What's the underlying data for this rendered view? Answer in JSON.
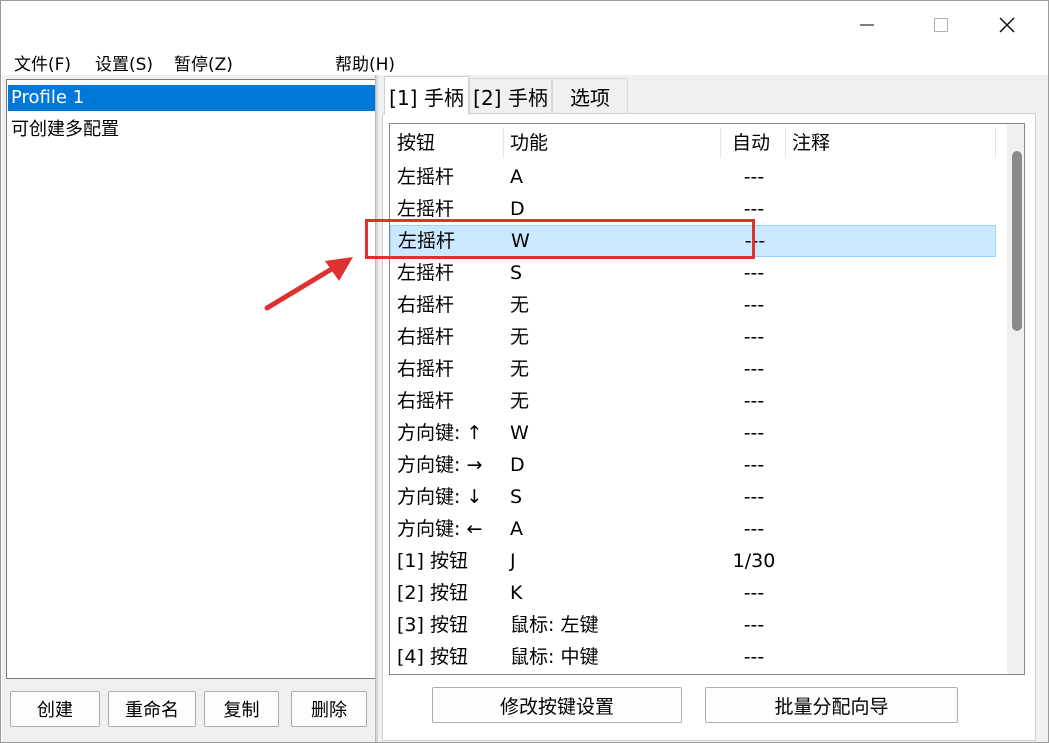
{
  "window": {
    "controls": {
      "minimize": "minimize-icon",
      "maximize": "maximize-icon",
      "close": "close-icon"
    }
  },
  "menu": {
    "file": "文件(F)",
    "settings": "设置(S)",
    "pause": "暂停(Z)",
    "help": "帮助(H)"
  },
  "profiles": {
    "items": [
      {
        "label": "Profile 1"
      },
      {
        "label": "可创建多配置"
      }
    ],
    "selected_index": 0,
    "buttons": {
      "create": "创建",
      "rename": "重命名",
      "copy": "复制",
      "delete": "删除"
    }
  },
  "tabs": [
    {
      "label": "[1] 手柄"
    },
    {
      "label": "[2] 手柄"
    },
    {
      "label": "选项"
    }
  ],
  "active_tab": 0,
  "table": {
    "columns": [
      "按钮",
      "功能",
      "自动",
      "注释"
    ],
    "rows": [
      {
        "button": "左摇杆",
        "function": "A",
        "auto": "---",
        "note": ""
      },
      {
        "button": "左摇杆",
        "function": "D",
        "auto": "---",
        "note": ""
      },
      {
        "button": "左摇杆",
        "function": "W",
        "auto": "---",
        "note": ""
      },
      {
        "button": "左摇杆",
        "function": "S",
        "auto": "---",
        "note": ""
      },
      {
        "button": "右摇杆",
        "function": "无",
        "auto": "---",
        "note": ""
      },
      {
        "button": "右摇杆",
        "function": "无",
        "auto": "---",
        "note": ""
      },
      {
        "button": "右摇杆",
        "function": "无",
        "auto": "---",
        "note": ""
      },
      {
        "button": "右摇杆",
        "function": "无",
        "auto": "---",
        "note": ""
      },
      {
        "button": "方向键: ↑",
        "function": "W",
        "auto": "---",
        "note": ""
      },
      {
        "button": "方向键: →",
        "function": "D",
        "auto": "---",
        "note": ""
      },
      {
        "button": "方向键: ↓",
        "function": "S",
        "auto": "---",
        "note": ""
      },
      {
        "button": "方向键: ←",
        "function": "A",
        "auto": "---",
        "note": ""
      },
      {
        "button": "[1] 按钮",
        "function": "J",
        "auto": "1/30",
        "note": ""
      },
      {
        "button": "[2] 按钮",
        "function": "K",
        "auto": "---",
        "note": ""
      },
      {
        "button": "[3] 按钮",
        "function": "鼠标: 左键",
        "auto": "---",
        "note": ""
      },
      {
        "button": "[4] 按钮",
        "function": "鼠标: 中键",
        "auto": "---",
        "note": ""
      }
    ],
    "selected_row": 2
  },
  "pane_buttons": {
    "modify": "修改按键设置",
    "batch": "批量分配向导"
  },
  "colors": {
    "selection": "#0078d7",
    "row_highlight": "#cce8ff",
    "annotation": "#e03131"
  }
}
